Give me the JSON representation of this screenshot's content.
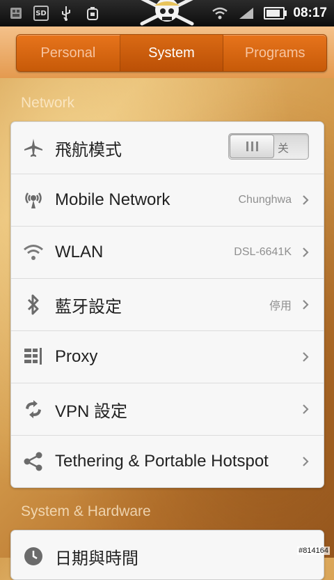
{
  "status_bar": {
    "time": "08:17",
    "sd_label": "SD",
    "battery_level": 0.85
  },
  "tabs": [
    {
      "label": "Personal",
      "active": false
    },
    {
      "label": "System",
      "active": true
    },
    {
      "label": "Programs",
      "active": false
    }
  ],
  "sections": {
    "network_header": "Network",
    "system_hardware_header": "System & Hardware"
  },
  "network_rows": {
    "airplane": {
      "label": "飛航模式",
      "toggle_off_label": "关",
      "icon": "airplane-icon"
    },
    "mobile": {
      "label": "Mobile Network",
      "value": "Chunghwa",
      "icon": "signal-tower-icon"
    },
    "wlan": {
      "label": "WLAN",
      "value": "DSL-6641K",
      "icon": "wifi-icon"
    },
    "bluetooth": {
      "label": "藍牙設定",
      "value": "停用",
      "icon": "bluetooth-icon"
    },
    "proxy": {
      "label": "Proxy",
      "value": "",
      "icon": "proxy-icon"
    },
    "vpn": {
      "label": "VPN 設定",
      "value": "",
      "icon": "vpn-icon"
    },
    "tethering": {
      "label": "Tethering & Portable Hotspot",
      "value": "",
      "icon": "share-icon"
    }
  },
  "system_rows": {
    "datetime": {
      "label": "日期與時間",
      "icon": "clock-icon"
    }
  },
  "watermark": "#814164",
  "colors": {
    "accent": "#d9650f",
    "card_bg": "#f7f7f7"
  }
}
